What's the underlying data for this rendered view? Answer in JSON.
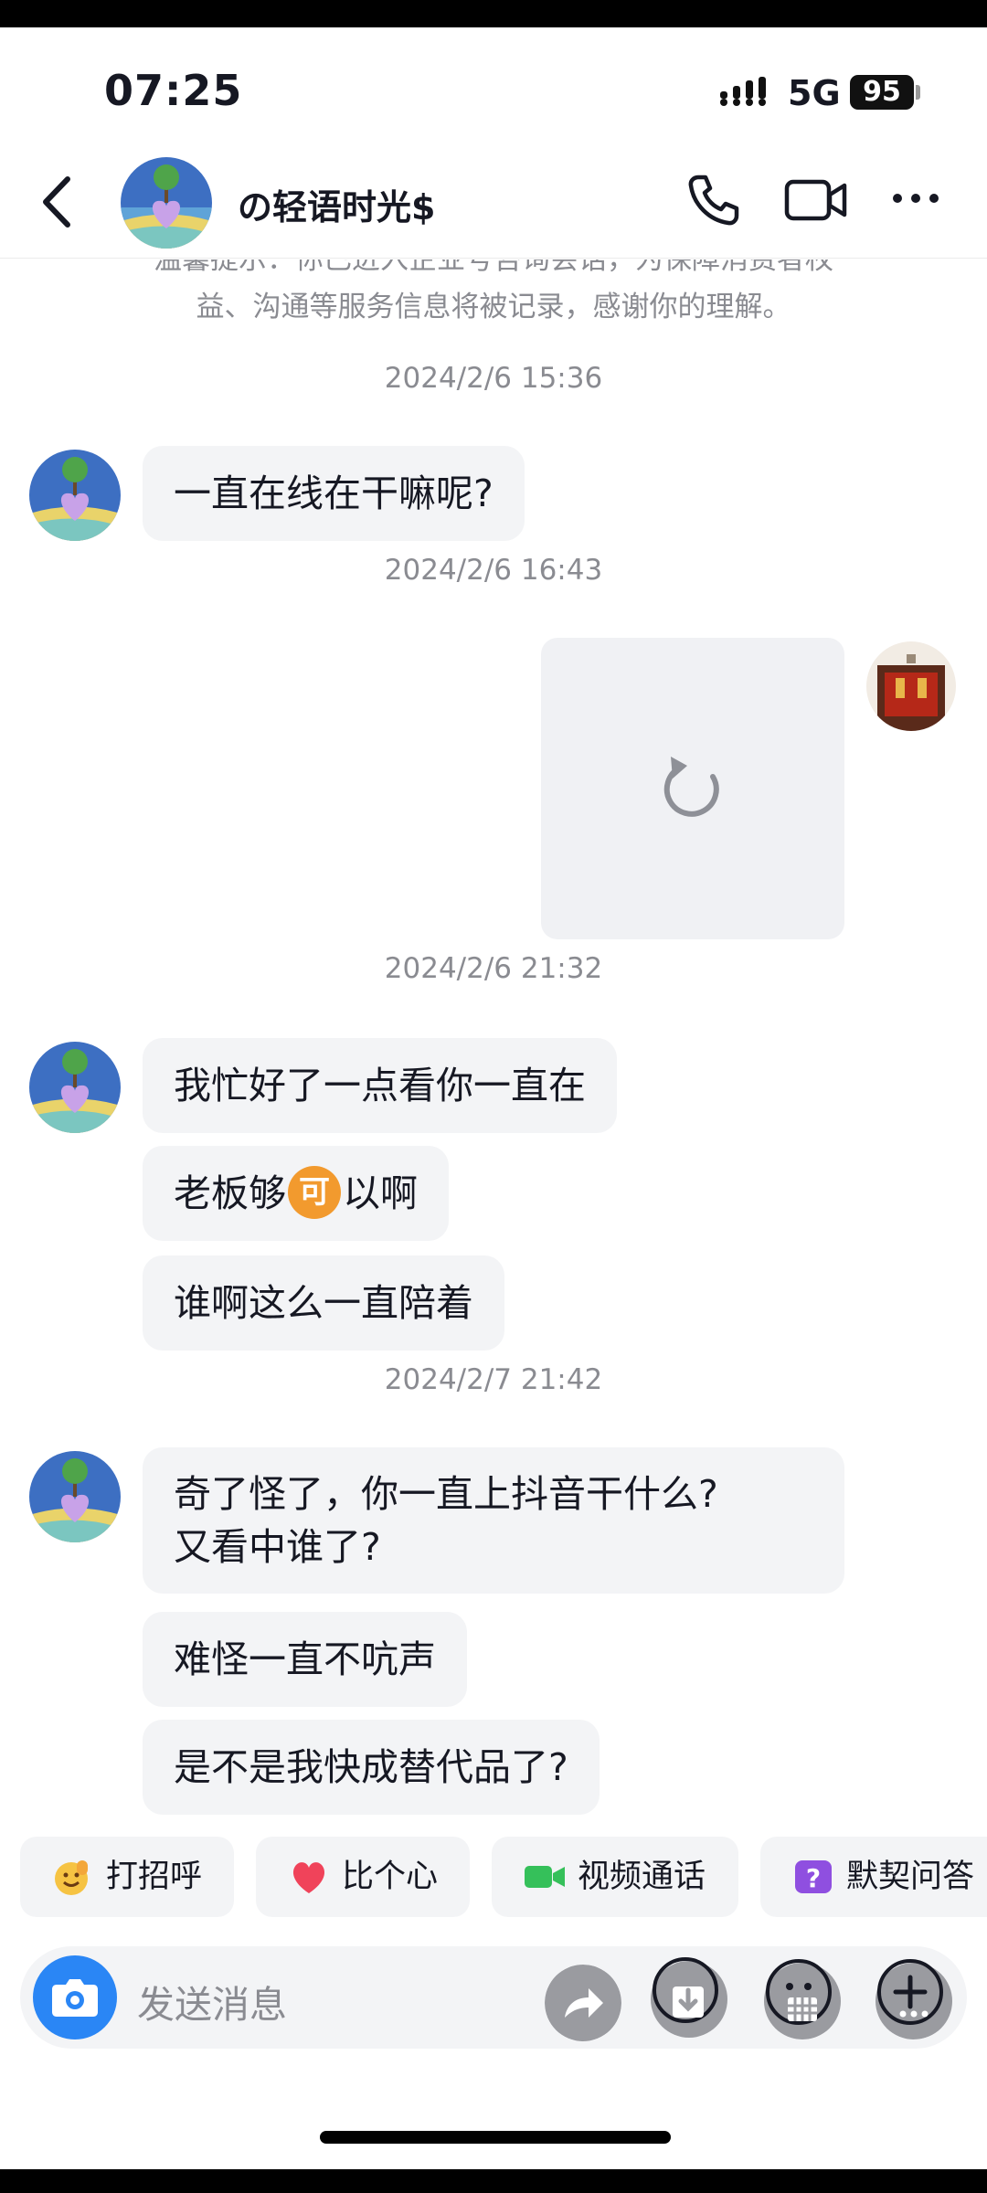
{
  "status_bar": {
    "time": "07:25",
    "network": "5G",
    "battery": "95"
  },
  "header": {
    "title": "の轻语时光$"
  },
  "notice": {
    "line1": "温馨提示：你已进入企业号咨询会话，为保障消费者权",
    "line2": "益、沟通等服务信息将被记录，感谢你的理解。"
  },
  "messages": {
    "ts1": "2024/2/6 15:36",
    "m1": "一直在线在干嘛呢?",
    "ts2": "2024/2/6 16:43",
    "ts3": "2024/2/6 21:32",
    "m2": "我忙好了一点看你一直在",
    "m3_before": "老板够",
    "m3_emoji": "可",
    "m3_after": "以啊",
    "m4": "谁啊这么一直陪着",
    "ts4": "2024/2/7 21:42",
    "m5_line1": "奇了怪了，你一直上抖音干什么?",
    "m5_line2": "又看中谁了?",
    "m6": "难怪一直不吭声",
    "m7": "是不是我快成替代品了?"
  },
  "quick_actions": [
    {
      "label": "打招呼",
      "icon": "wave-hand-icon"
    },
    {
      "label": "比个心",
      "icon": "heart-icon"
    },
    {
      "label": "视频通话",
      "icon": "video-call-icon"
    },
    {
      "label": "默契问答",
      "icon": "question-icon"
    }
  ],
  "input": {
    "placeholder": "发送消息"
  },
  "colors": {
    "accent": "#2a86f5",
    "bubble": "#f3f4f6",
    "muted": "#8a8b91",
    "heart": "#f0435a",
    "video": "#35c05a",
    "quiz": "#8f4fe0"
  }
}
